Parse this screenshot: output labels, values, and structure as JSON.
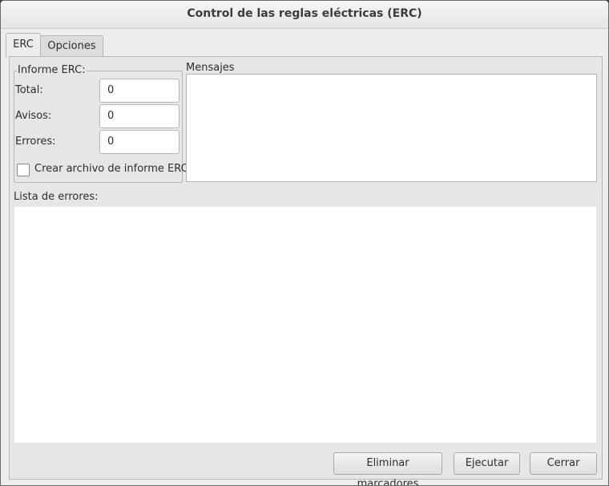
{
  "window": {
    "title": "Control de las reglas eléctricas (ERC)"
  },
  "tabs": [
    {
      "label": "ERC",
      "selected": true
    },
    {
      "label": "Opciones",
      "selected": false
    }
  ],
  "report": {
    "group_label": "Informe ERC:",
    "total_label": "Total:",
    "total_value": "0",
    "warnings_label": "Avisos:",
    "warnings_value": "0",
    "errors_label": "Errores:",
    "errors_value": "0",
    "create_file_label": "Crear archivo de informe ERC",
    "create_file_checked": false
  },
  "messages": {
    "label": "Mensajes"
  },
  "errors_list": {
    "label": "Lista de errores:"
  },
  "buttons": {
    "delete_markers": "Eliminar marcadores",
    "run": "Ejecutar",
    "close": "Cerrar"
  }
}
